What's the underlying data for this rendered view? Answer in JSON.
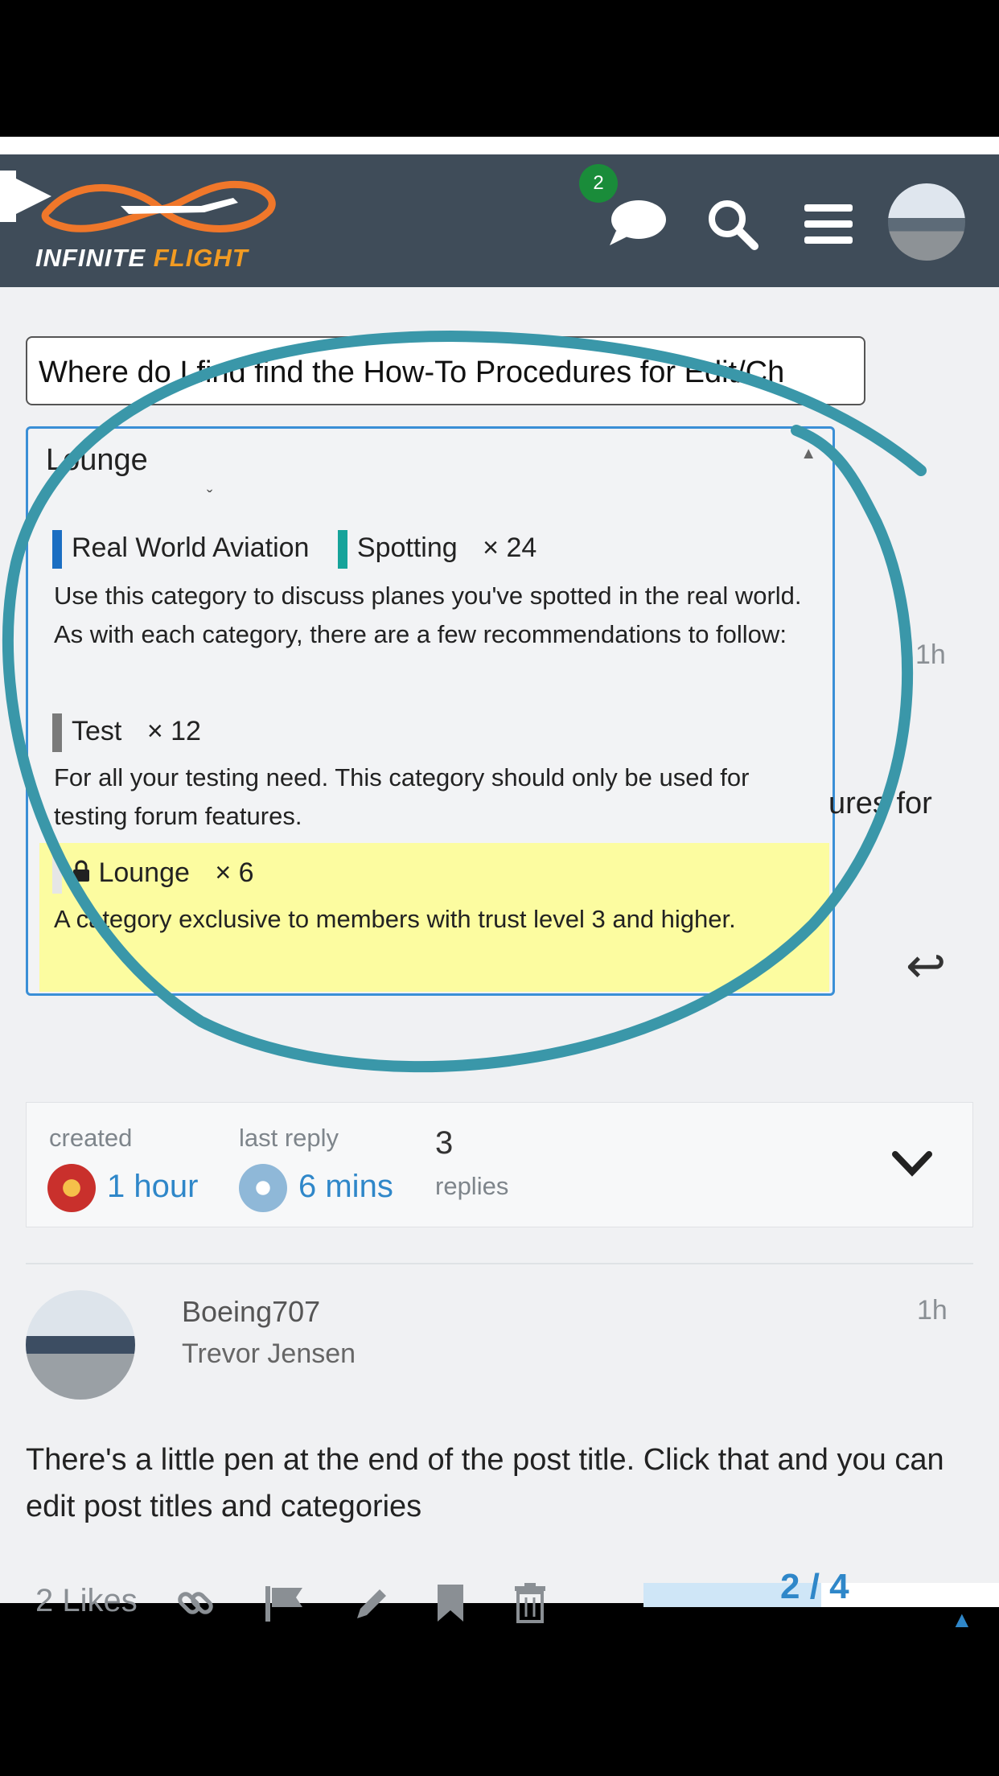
{
  "header": {
    "logo_text_primary": "INFINITE",
    "logo_text_accent": "FLIGHT",
    "notification_count": "2",
    "icons": [
      "chat-bubble-icon",
      "search-icon",
      "hamburger-menu-icon"
    ]
  },
  "composer": {
    "title_value": "Where do I find find the How-To Procedures for Edit/Ch"
  },
  "category_dropdown": {
    "selected": "Lounge",
    "options": [
      {
        "parent": "Real World Aviation",
        "parent_color": "#1b6ec2",
        "name": "Spotting",
        "color": "#16a39a",
        "count": "× 24",
        "description": "Use this category to discuss planes you've spotted in the real world. As with each category, there are a few recommendations to follow:"
      },
      {
        "name": "Test",
        "color": "#7a7a7a",
        "count": "× 12",
        "description": "For all your testing need. This category should only be used for testing forum features."
      },
      {
        "name": "Lounge",
        "color": "#e6e6e6",
        "count": "× 6",
        "locked": true,
        "description": "A category exclusive to members with trust level 3 and higher."
      }
    ]
  },
  "background_post": {
    "time": "1h",
    "partial_text": "ures for"
  },
  "topic_stats": {
    "created_label": "created",
    "created_value": "1 hour",
    "last_reply_label": "last reply",
    "last_reply_value": "6 mins",
    "replies_count": "3",
    "replies_label": "replies"
  },
  "post": {
    "username": "Boeing707",
    "full_name": "Trevor Jensen",
    "time": "1h",
    "body": "There's a little pen at the end of the post title. Click that and you can edit post titles and categories"
  },
  "post_actions": {
    "likes": "2 Likes",
    "icons": [
      "link-icon",
      "flag-icon",
      "pencil-icon",
      "bookmark-icon",
      "trash-icon"
    ]
  },
  "progress": {
    "current": "2",
    "total": "4",
    "fraction": 0.5
  },
  "colors": {
    "header_bg": "#3f4c59",
    "accent_blue": "#2f87c9",
    "annotation_circle": "#3a97a9",
    "highlight_yellow": "#fcfca0"
  }
}
